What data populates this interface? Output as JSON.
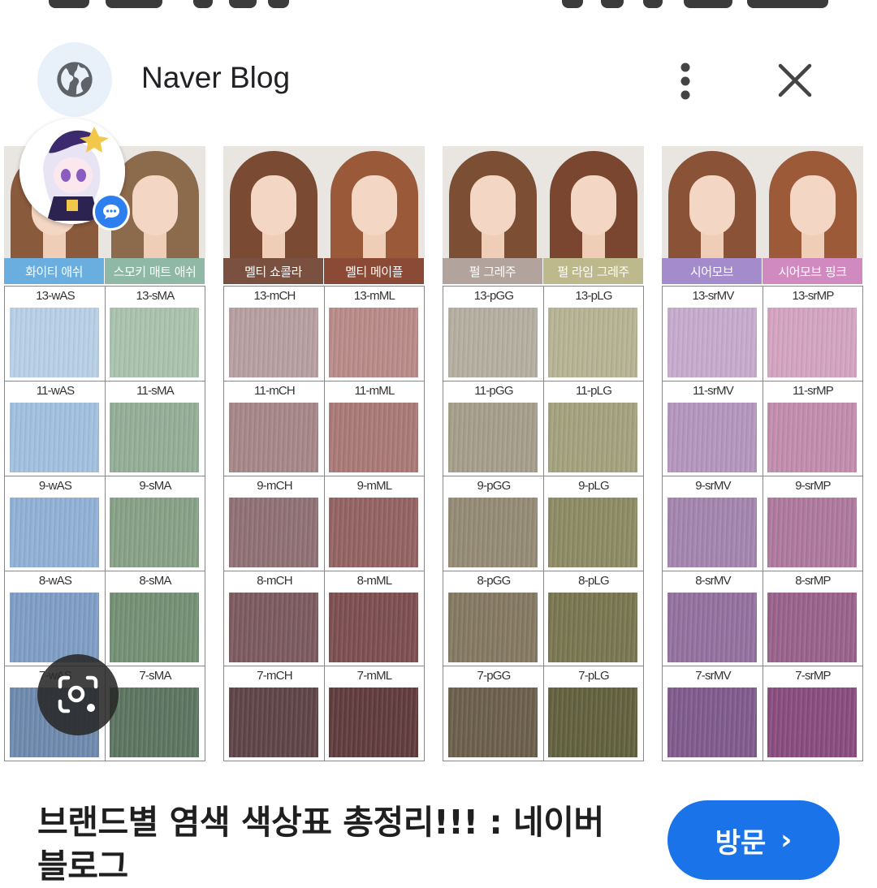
{
  "header": {
    "site_name": "Naver Blog",
    "globe_icon": "globe-icon",
    "more_icon": "more-vert-icon",
    "close_icon": "close-icon"
  },
  "image": {
    "panels": [
      {
        "labels": [
          "화이티 애쉬",
          "스모키 매트 애쉬"
        ],
        "label_colors": [
          "#6aaee0",
          "#8fb8a6"
        ],
        "hair_colors": [
          "#8a5a3c",
          "#8c6a4c"
        ],
        "codes_left": [
          "13-wAS",
          "11-wAS",
          "9-wAS",
          "8-wAS",
          "7-wAS"
        ],
        "codes_right": [
          "13-sMA",
          "11-sMA",
          "9-sMA",
          "8-sMA",
          "7-sMA"
        ],
        "swatch_left": [
          "#b7cfe6",
          "#a1bfdf",
          "#8fb0d5",
          "#7e9dc4",
          "#6d89ad"
        ],
        "swatch_right": [
          "#a9c2ad",
          "#93ad96",
          "#86a086",
          "#738f74",
          "#5c7460"
        ]
      },
      {
        "labels": [
          "멜티 쇼콜라",
          "멜티 메이플"
        ],
        "label_colors": [
          "#7a5040",
          "#8a4a36"
        ],
        "hair_colors": [
          "#7a4a32",
          "#9a5a3a"
        ],
        "codes_left": [
          "13-mCH",
          "11-mCH",
          "9-mCH",
          "8-mCH",
          "7-mCH"
        ],
        "codes_right": [
          "13-mML",
          "11-mML",
          "9-mML",
          "8-mML",
          "7-mML"
        ],
        "swatch_left": [
          "#b79ea0",
          "#a68688",
          "#8f7074",
          "#7b5a5e",
          "#5e4446"
        ],
        "swatch_right": [
          "#b88a88",
          "#a87876",
          "#936262",
          "#7c4e50",
          "#5f3b3c"
        ]
      },
      {
        "labels": [
          "펄 그레주",
          "펄 라임 그레주"
        ],
        "label_colors": [
          "#b2a49c",
          "#bdb98c"
        ],
        "hair_colors": [
          "#7c4e34",
          "#7a4630"
        ],
        "codes_left": [
          "13-pGG",
          "11-pGG",
          "9-pGG",
          "8-pGG",
          "7-pGG"
        ],
        "codes_right": [
          "13-pLG",
          "11-pLG",
          "9-pLG",
          "8-pLG",
          "7-pLG"
        ],
        "swatch_left": [
          "#b4aea0",
          "#a59d8a",
          "#948a74",
          "#847861",
          "#6b5e4b"
        ],
        "swatch_right": [
          "#b5b393",
          "#a3a17c",
          "#8c8a62",
          "#78754f",
          "#61603e"
        ]
      },
      {
        "labels": [
          "시어모브",
          "시어모브 핑크"
        ],
        "label_colors": [
          "#a48ccc",
          "#d08abf"
        ],
        "hair_colors": [
          "#8a5236",
          "#9c5a38"
        ],
        "codes_left": [
          "13-srMV",
          "11-srMV",
          "9-srMV",
          "8-srMV",
          "7-srMV"
        ],
        "codes_right": [
          "13-srMP",
          "11-srMP",
          "9-srMP",
          "8-srMP",
          "7-srMP"
        ],
        "swatch_left": [
          "#c6aacd",
          "#b495bd",
          "#a384ae",
          "#93709e",
          "#7f5a8c"
        ],
        "swatch_right": [
          "#d3a3c0",
          "#c18cad",
          "#ad789c",
          "#98618a",
          "#884b7d"
        ]
      }
    ]
  },
  "result": {
    "title": "브랜드별 염색 색상표 총정리!!! : 네이버 블로그",
    "visit_label": "방문",
    "visit_chevron": "›",
    "accent": "#1a73e8"
  },
  "overlays": {
    "avatar_icon": "profile-avatar",
    "chat_icon": "chat-bubble-icon",
    "lens_icon": "lens-search-icon"
  }
}
